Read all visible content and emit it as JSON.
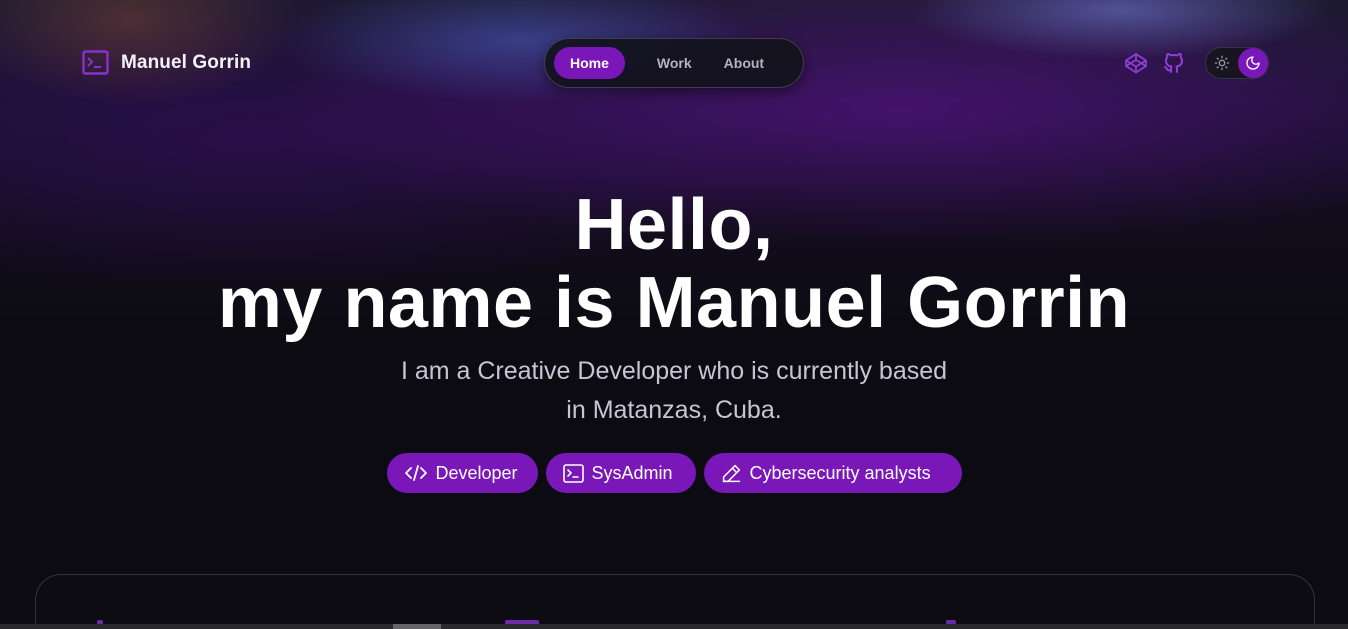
{
  "brand": {
    "name": "Manuel Gorrin",
    "icon": "terminal-icon"
  },
  "nav": {
    "items": [
      {
        "label": "Home",
        "active": true
      },
      {
        "label": "Work",
        "active": false
      },
      {
        "label": "About",
        "active": false
      }
    ]
  },
  "header_icons": [
    "codepen-icon",
    "github-icon"
  ],
  "theme_toggle": {
    "options": [
      "sun-icon",
      "moon-icon"
    ],
    "selected": "dark"
  },
  "hero": {
    "title_line1": "Hello,",
    "title_line2": "my name is Manuel Gorrin",
    "subtitle_line1": "I am a Creative Developer who is currently based",
    "subtitle_line2": "in Matanzas, Cuba."
  },
  "chips": [
    {
      "label": "Developer",
      "icon": "code-icon"
    },
    {
      "label": "SysAdmin",
      "icon": "terminal-icon"
    },
    {
      "label": "Cybersecurity analysts",
      "icon": "pencil-icon"
    }
  ],
  "colors": {
    "accent": "#7a17b8",
    "background": "#0c0b12",
    "text_muted": "#c7c5d2"
  }
}
